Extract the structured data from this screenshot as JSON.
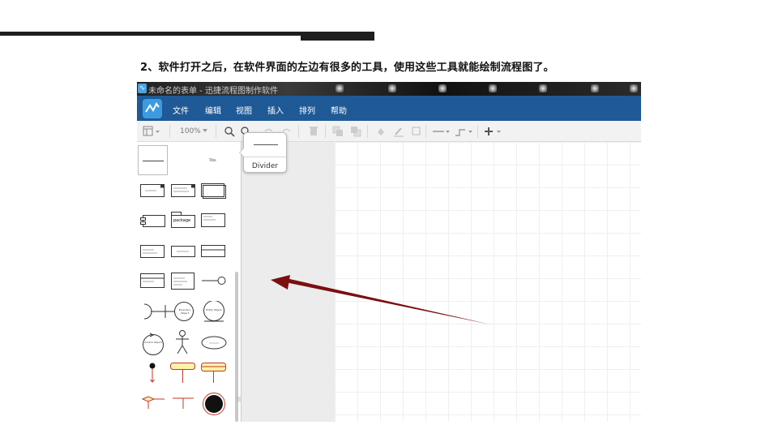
{
  "caption": "2、软件打开之后，在软件界面的左边有很多的工具，使用这些工具就能绘制流程图了。",
  "window": {
    "title": "未命名的表单 - 迅捷流程图制作软件"
  },
  "menu": [
    "文件",
    "编辑",
    "视图",
    "插入",
    "排列",
    "帮助"
  ],
  "toolbar": {
    "zoom": "100%",
    "icons": [
      "layout-icon",
      "zoom-in-icon",
      "zoom-out-icon",
      "undo-icon",
      "redo-icon",
      "delete-icon",
      "to-front-icon",
      "to-back-icon",
      "fill-color-icon",
      "line-color-icon",
      "shadow-icon",
      "line-style-icon",
      "connector-icon",
      "insert-icon"
    ]
  },
  "shapes": {
    "title_label": "Title",
    "package_label": "package",
    "object_label": "Object",
    "boundary_label": "Boundary Object",
    "entity_label": "Entity Object",
    "control_label": "Control Object"
  },
  "tooltip": {
    "label": "Divider"
  },
  "colors": {
    "menubar": "#1f5a96",
    "arrow": "#7a0f0f",
    "accent": "#3c9be0"
  }
}
